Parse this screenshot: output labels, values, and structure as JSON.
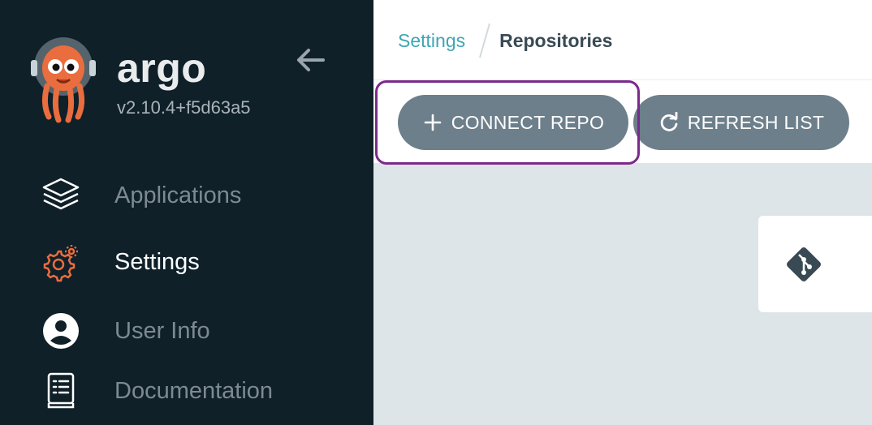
{
  "sidebar": {
    "brand_name": "argo",
    "version": "v2.10.4+f5d63a5",
    "collapse_icon": "arrow-left-icon",
    "items": [
      {
        "label": "Applications",
        "icon": "layers-icon",
        "active": false
      },
      {
        "label": "Settings",
        "icon": "gear-icon",
        "active": true
      },
      {
        "label": "User Info",
        "icon": "user-circle-icon",
        "active": false
      },
      {
        "label": "Documentation",
        "icon": "book-icon",
        "active": false
      }
    ]
  },
  "breadcrumb": {
    "parent": "Settings",
    "current": "Repositories"
  },
  "toolbar": {
    "connect_label": "CONNECT REPO",
    "connect_icon": "plus-icon",
    "refresh_label": "REFRESH LIST",
    "refresh_icon": "refresh-icon"
  },
  "card": {
    "icon": "git-icon"
  },
  "colors": {
    "sidebar_bg": "#0f2029",
    "main_bg": "#dee5e8",
    "accent_teal": "#3fa4b5",
    "button_bg": "#6d7f8b",
    "highlight_border": "#7b2a8a",
    "argo_orange": "#e96d3f"
  }
}
